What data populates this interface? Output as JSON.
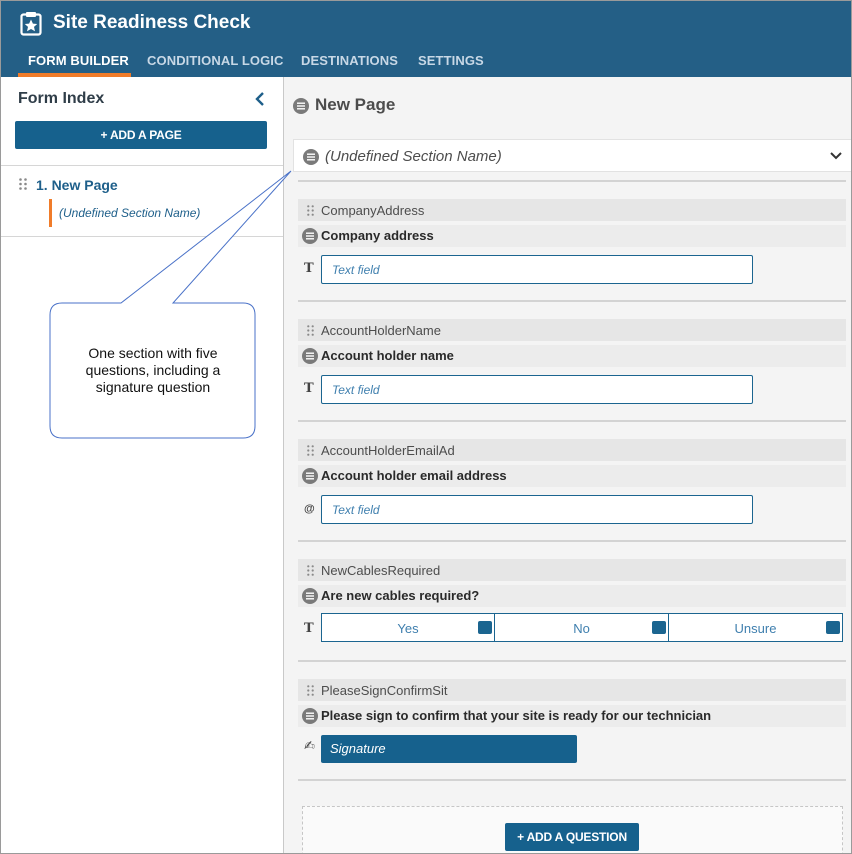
{
  "app": {
    "title": "Site Readiness Check",
    "accent_color": "#245f86",
    "active_tab_color": "#f07c2a"
  },
  "tabs": [
    {
      "label": "FORM BUILDER",
      "active": true
    },
    {
      "label": "CONDITIONAL LOGIC",
      "active": false
    },
    {
      "label": "DESTINATIONS",
      "active": false
    },
    {
      "label": "SETTINGS",
      "active": false
    }
  ],
  "sidebar": {
    "title": "Form Index",
    "collapse_icon": "chevron-left-icon",
    "add_page_label": "+ ADD A PAGE",
    "page_label": "1. New Page",
    "section_label": "(Undefined Section Name)"
  },
  "main": {
    "page_title": "New Page",
    "section_title": "(Undefined Section Name)",
    "questions": [
      {
        "name": "CompanyAddress",
        "label": "Company address",
        "type_icon": "T",
        "placeholder": "Text field"
      },
      {
        "name": "AccountHolderName",
        "label": "Account holder name",
        "type_icon": "T",
        "placeholder": "Text field"
      },
      {
        "name": "AccountHolderEmailAd",
        "label": "Account holder email address",
        "type_icon": "@",
        "placeholder": "Text field"
      },
      {
        "name": "NewCablesRequired",
        "label": "Are new cables required?",
        "type_icon": "T",
        "choices": [
          "Yes",
          "No",
          "Unsure"
        ]
      },
      {
        "name": "PleaseSignConfirmSit",
        "label": "Please sign to confirm that your site is ready for our technician",
        "type_icon": "✍",
        "button_label": "Signature"
      }
    ],
    "add_question_label": "+ ADD A QUESTION"
  },
  "callout": {
    "text": "One section with five questions, including a signature question"
  }
}
